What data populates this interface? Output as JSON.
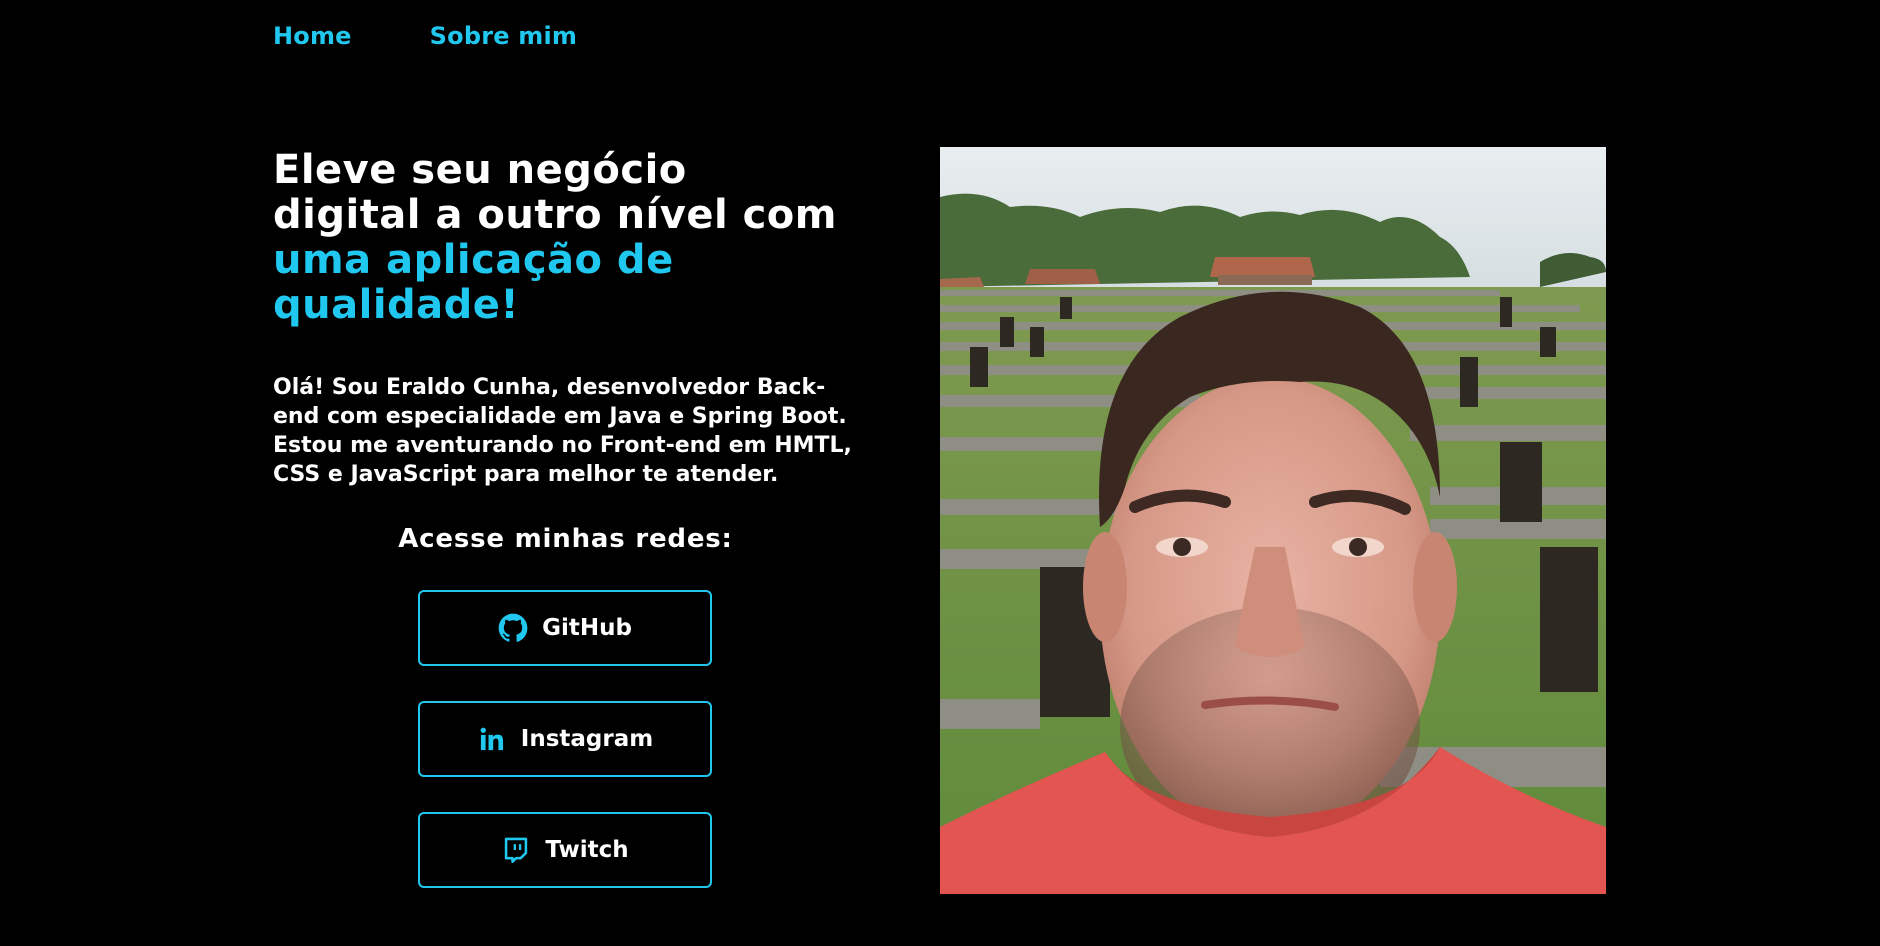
{
  "nav": {
    "home_label": "Home",
    "about_label": "Sobre mim"
  },
  "hero": {
    "headline_line1": "Eleve seu negócio",
    "headline_line2": "digital a outro nível com",
    "headline_accent_line1": "uma aplicação de",
    "headline_accent_line2": "qualidade!",
    "intro_line1": "Olá! Sou Eraldo Cunha, desenvolvedor Back-",
    "intro_line2": "end com especialidade em Java e Spring Boot.",
    "intro_line3": "Estou me aventurando no Front-end em HMTL,",
    "intro_line4": "CSS e JavaScript para melhor te atender."
  },
  "social": {
    "title": "Acesse minhas redes:",
    "buttons": [
      {
        "label": "GitHub",
        "icon": "github-icon"
      },
      {
        "label": "Instagram",
        "icon": "linkedin-icon"
      },
      {
        "label": "Twitch",
        "icon": "twitch-icon"
      }
    ]
  },
  "photo": {
    "subject": "profile-photo"
  },
  "colors": {
    "background": "#000000",
    "accent": "#20c8f0",
    "text": "#ffffff"
  }
}
